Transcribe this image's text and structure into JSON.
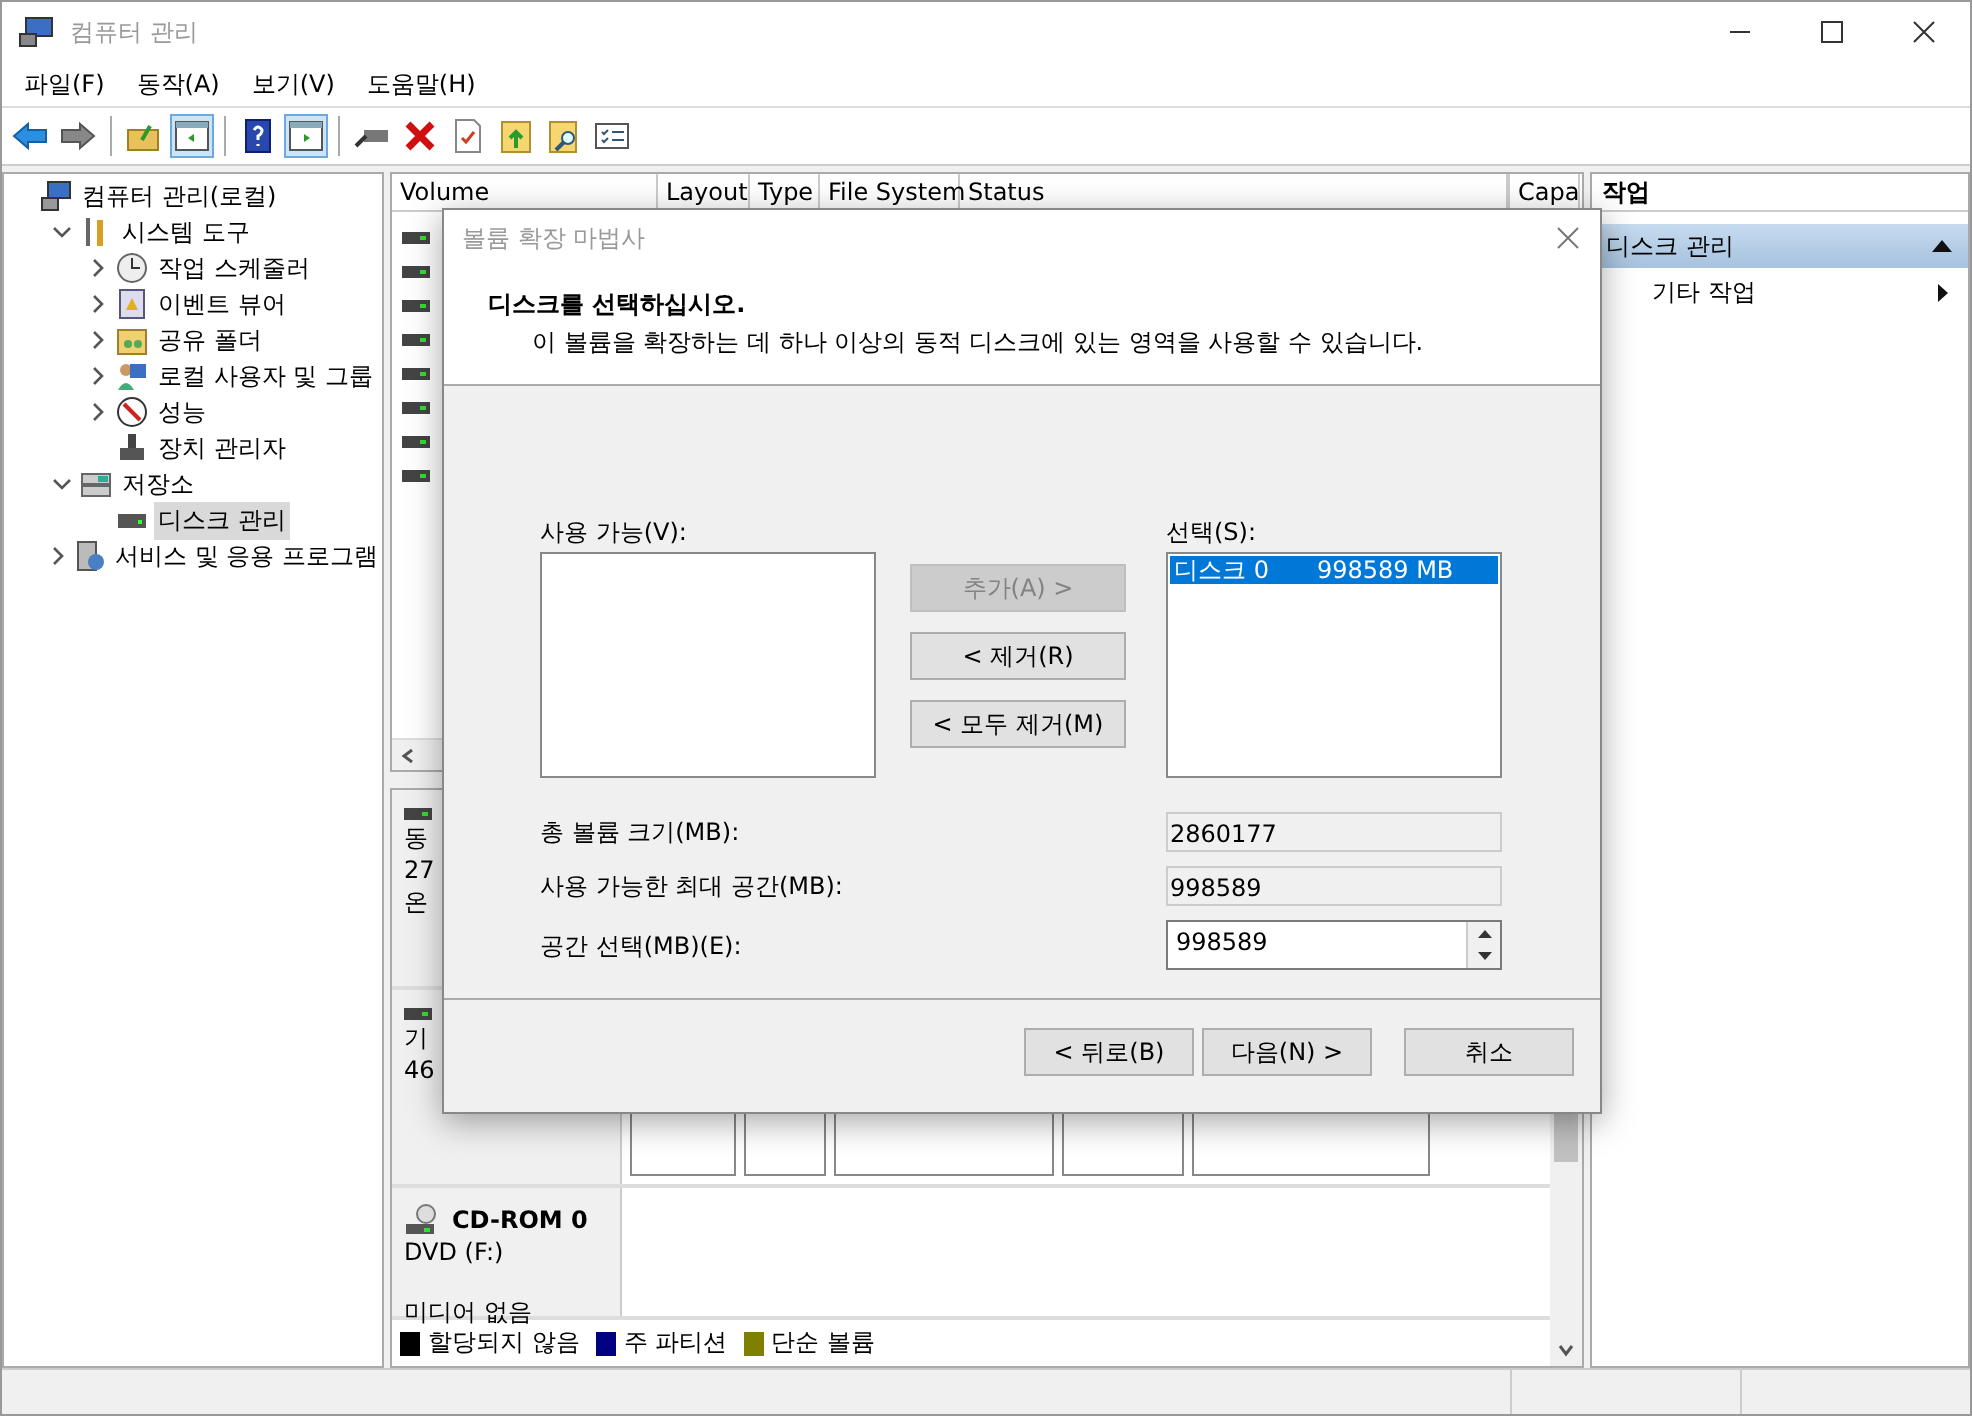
{
  "window": {
    "title": "컴퓨터 관리"
  },
  "menu": [
    "파일(F)",
    "동작(A)",
    "보기(V)",
    "도움말(H)"
  ],
  "toolbar": [
    {
      "kind": "back",
      "selected": false
    },
    {
      "kind": "forward",
      "selected": false
    },
    {
      "kind": "up",
      "selected": false
    },
    {
      "kind": "tree",
      "selected": true
    },
    {
      "kind": "help",
      "selected": false
    },
    {
      "kind": "pane",
      "selected": true
    },
    {
      "kind": "connect",
      "selected": false
    },
    {
      "kind": "delete",
      "selected": false
    },
    {
      "kind": "properties",
      "selected": false
    },
    {
      "kind": "export",
      "selected": false
    },
    {
      "kind": "find",
      "selected": false
    },
    {
      "kind": "list",
      "selected": false
    }
  ],
  "tree": [
    {
      "label": "컴퓨터 관리(로컬)",
      "selected": false,
      "children": [
        {
          "label": "시스템 도구",
          "expanded": true,
          "selected": false,
          "children": [
            {
              "label": "작업 스케줄러",
              "expanded": false,
              "selected": false
            },
            {
              "label": "이벤트 뷰어",
              "expanded": false,
              "selected": false
            },
            {
              "label": "공유 폴더",
              "expanded": false,
              "selected": false
            },
            {
              "label": "로컬 사용자 및 그룹",
              "expanded": false,
              "selected": false
            },
            {
              "label": "성능",
              "expanded": false,
              "selected": false
            },
            {
              "label": "장치 관리자",
              "selected": false
            }
          ]
        },
        {
          "label": "저장소",
          "expanded": true,
          "selected": false,
          "children": [
            {
              "label": "디스크 관리",
              "selected": true
            }
          ]
        },
        {
          "label": "서비스 및 응용 프로그램",
          "expanded": false,
          "selected": false
        }
      ]
    }
  ],
  "volume_table": {
    "columns": [
      "Volume",
      "Layout",
      "Type",
      "File System",
      "Status",
      "Capa"
    ],
    "rows": [
      {
        "kind": "disk"
      },
      {
        "kind": "disk"
      },
      {
        "kind": "disk"
      },
      {
        "kind": "disk"
      },
      {
        "kind": "disk"
      },
      {
        "kind": "disk"
      },
      {
        "kind": "disk"
      },
      {
        "kind": "disk"
      }
    ]
  },
  "disks": [
    {
      "kind": "partial",
      "lines": [
        "동",
        "27",
        "온"
      ]
    },
    {
      "kind": "partial",
      "lines": [
        "기",
        "46"
      ]
    },
    {
      "kind": "cdrom",
      "name": "CD-ROM 0",
      "type": "DVD (F:)",
      "status": "미디어 없음"
    }
  ],
  "legend": [
    {
      "label": "할당되지 않음",
      "color": "#000000"
    },
    {
      "label": "주 파티션",
      "color": "#000080"
    },
    {
      "label": "단순 볼륨",
      "color": "#808000"
    }
  ],
  "actions": {
    "title": "작업",
    "section": {
      "label": "디스크 관리",
      "expanded": true
    },
    "items": [
      "기타 작업"
    ]
  },
  "dialog": {
    "title": "볼륨 확장 마법사",
    "heading": "디스크를 선택하십시오.",
    "subheading": "이 볼륨을 확장하는 데 하나 이상의 동적 디스크에 있는 영역을 사용할 수 있습니다.",
    "available": {
      "label": "사용 가능(V):"
    },
    "move_buttons": [
      {
        "label": "추가(A) >",
        "disabled": true
      },
      {
        "label": "< 제거(R)",
        "disabled": false
      },
      {
        "label": "< 모두 제거(M)",
        "disabled": false
      }
    ],
    "selected_list": {
      "label": "선택(S):",
      "items": [
        {
          "disk": "디스크 0",
          "size": "998589 MB",
          "selected": true
        }
      ]
    },
    "fields": [
      {
        "label": "총 볼륨 크기(MB):",
        "value": "2860177",
        "kind": "readonly"
      },
      {
        "label": "사용 가능한 최대 공간(MB):",
        "value": "998589",
        "kind": "readonly"
      },
      {
        "label": "공간 선택(MB)(E):",
        "value": "998589",
        "kind": "spin"
      }
    ],
    "buttons": [
      {
        "label": "< 뒤로(B)",
        "kind": "nav"
      },
      {
        "label": "다음(N) >",
        "kind": "nav"
      },
      {
        "label": "취소",
        "kind": "cancel"
      }
    ]
  }
}
